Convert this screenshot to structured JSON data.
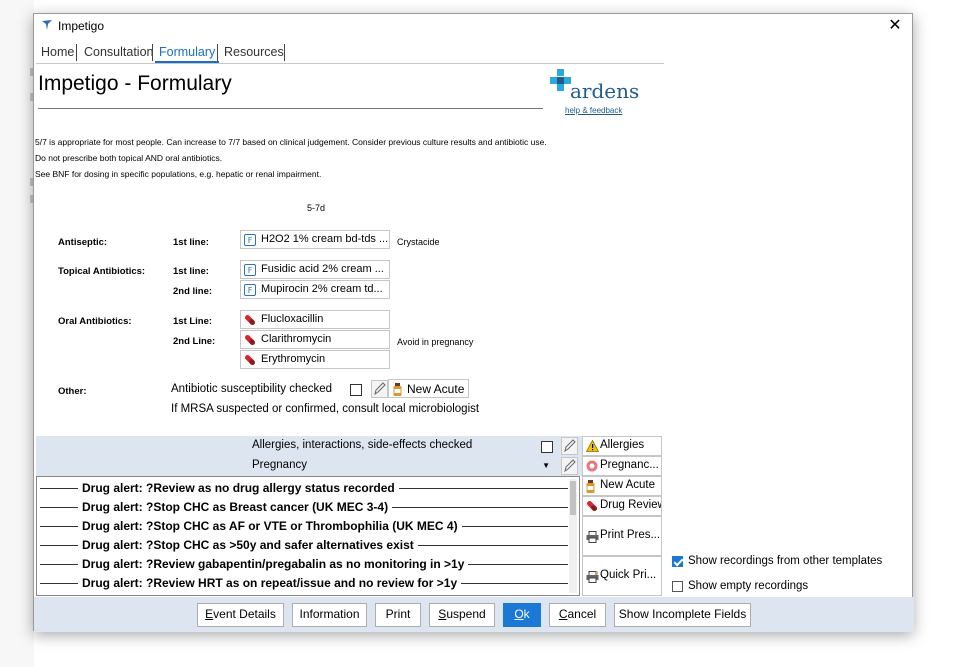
{
  "window": {
    "title": "Impetigo"
  },
  "tabs": [
    {
      "label": "Home"
    },
    {
      "label": "Consultation"
    },
    {
      "label": "Formulary"
    },
    {
      "label": "Resources"
    }
  ],
  "heading": "Impetigo - Formulary",
  "logo": {
    "name": "ardens",
    "link": "help & feedback",
    "colors": [
      "#29a9e0",
      "#1f5b8f"
    ]
  },
  "notes": [
    "5/7 is appropriate for most people. Can increase to 7/7 based on clinical judgement. Consider previous culture results and antibiotic use.",
    "Do not prescribe both topical AND oral antibiotics.",
    "See BNF for dosing in specific populations, e.g. hepatic or renal impairment."
  ],
  "formulary": {
    "column_header": "5-7d",
    "antiseptic": {
      "label": "Antiseptic:",
      "line1": "1st line:",
      "drug1": "H2O2 1% cream bd-tds ...",
      "note": "Crystacide"
    },
    "topical": {
      "label": "Topical Antibiotics:",
      "line1": "1st line:",
      "drug1": "Fusidic acid 2% cream ...",
      "line2": "2nd line:",
      "drug2": "Mupirocin 2% cream td..."
    },
    "oral": {
      "label": "Oral Antibiotics:",
      "line1": "1st Line:",
      "drug1": "Flucloxacillin",
      "line2": "2nd Line:",
      "drug2": "Clarithromycin",
      "drug3": "Erythromycin",
      "note": "Avoid in pregnancy"
    },
    "other": {
      "label": "Other:",
      "check_text": "Antibiotic susceptibility checked",
      "new_acute": "New Acute",
      "mrsa_text": "If MRSA suspected or confirmed, consult local microbiologist"
    }
  },
  "checks": {
    "allergies_label": "Allergies, interactions, side-effects checked",
    "pregnancy_label": "Pregnancy"
  },
  "side_buttons": {
    "allergies": "Allergies",
    "pregnancy": "Pregnanc...",
    "new_acute": "New Acute",
    "drug_review": "Drug Review",
    "print_pres": "Print Pres...",
    "quick_pri": "Quick Pri..."
  },
  "alerts": [
    "Drug alert: ?Review as no drug allergy status recorded",
    "Drug alert: ?Stop CHC as Breast cancer (UK MEC 3-4)",
    "Drug alert: ?Stop CHC as AF or VTE or Thrombophilia (UK MEC 4)",
    "Drug alert: ?Stop CHC as >50y and safer alternatives exist",
    "Drug alert: ?Review gabapentin/pregabalin as no monitoring in >1y",
    "Drug alert: ?Review HRT as on repeat/issue and no review for >1y"
  ],
  "options": {
    "show_other": {
      "label": "Show recordings from other templates",
      "checked": true
    },
    "show_empty": {
      "label": "Show empty recordings",
      "checked": false
    }
  },
  "footer": {
    "event_details": {
      "accel": "E",
      "rest": "vent Details"
    },
    "information": "Information",
    "print": "Print",
    "suspend": {
      "accel": "S",
      "rest": "uspend"
    },
    "ok": {
      "accel": "O",
      "rest": "k"
    },
    "cancel": {
      "accel": "C",
      "rest": "ancel"
    },
    "show_incomplete": "Show Incomplete Fields"
  },
  "colors": {
    "accent": "#1b78d4",
    "tab_active": "#1b6ec2",
    "bar": "#dde6f0"
  }
}
